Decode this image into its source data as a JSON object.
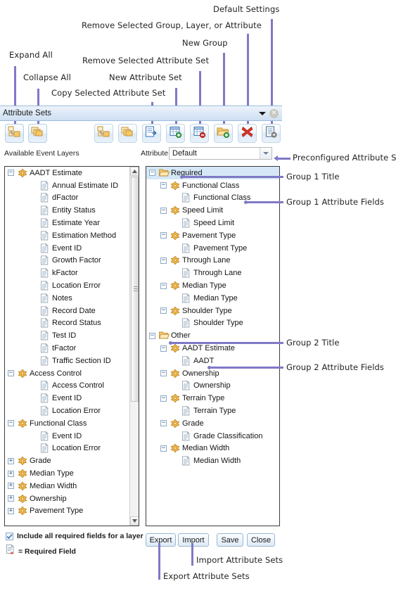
{
  "annotations": {
    "top": [
      {
        "text": "Default Settings"
      },
      {
        "text": "Remove Selected Group, Layer, or Attribute"
      },
      {
        "text": "New Group"
      },
      {
        "text": "Expand All"
      },
      {
        "text": "Remove Selected Attribute Set"
      },
      {
        "text": "Collapse All"
      },
      {
        "text": "New Attribute Set"
      },
      {
        "text": "Copy Selected Attribute Set"
      }
    ],
    "right": [
      {
        "text": "Preconfigured Attribute Set"
      },
      {
        "text": "Group 1 Title"
      },
      {
        "text": "Group 1 Attribute Fields"
      },
      {
        "text": "Group 2 Title"
      },
      {
        "text": "Group 2 Attribute Fields"
      }
    ],
    "bottom": [
      {
        "text": "Import Attribute Sets"
      },
      {
        "text": "Export Attribute Sets"
      }
    ]
  },
  "window": {
    "title": "Attribute Sets",
    "menu_icon": "chevron-down-icon",
    "close_icon": "close-icon"
  },
  "toolbar": {
    "buttons": [
      {
        "name": "expand-all",
        "icon": "expand-all-icon"
      },
      {
        "name": "collapse-all",
        "icon": "collapse-all-icon"
      },
      {
        "name": "expand-all-right",
        "icon": "expand-all-icon"
      },
      {
        "name": "collapse-all-right",
        "icon": "collapse-all-icon"
      },
      {
        "name": "copy-selected-attribute-set",
        "icon": "copy-attribute-set-icon"
      },
      {
        "name": "new-attribute-set",
        "icon": "new-attribute-set-icon"
      },
      {
        "name": "remove-selected-attribute-set",
        "icon": "remove-attribute-set-icon"
      },
      {
        "name": "new-group",
        "icon": "new-group-folder-icon"
      },
      {
        "name": "remove-selected-group-layer-attribute",
        "icon": "red-x-icon"
      },
      {
        "name": "default-settings",
        "icon": "default-settings-icon"
      }
    ]
  },
  "labels": {
    "available_event_layers": "Available Event Layers",
    "attribute_set": "Attribute Set:"
  },
  "attribute_set_combo": {
    "value": "Default",
    "options": [
      "Default"
    ]
  },
  "left_tree": {
    "nodes": [
      {
        "label": "AADT Estimate",
        "depth": 0,
        "icon": "layer-icon",
        "toggle": "minus"
      },
      {
        "label": "Annual Estimate ID",
        "depth": 2,
        "icon": "field-icon",
        "toggle": null
      },
      {
        "label": "dFactor",
        "depth": 2,
        "icon": "field-icon",
        "toggle": null
      },
      {
        "label": "Entity Status",
        "depth": 2,
        "icon": "field-icon",
        "toggle": null
      },
      {
        "label": "Estimate Year",
        "depth": 2,
        "icon": "field-icon",
        "toggle": null
      },
      {
        "label": "Estimation Method",
        "depth": 2,
        "icon": "field-icon",
        "toggle": null
      },
      {
        "label": "Event ID",
        "depth": 2,
        "icon": "field-icon",
        "toggle": null
      },
      {
        "label": "Growth Factor",
        "depth": 2,
        "icon": "field-icon",
        "toggle": null
      },
      {
        "label": "kFactor",
        "depth": 2,
        "icon": "field-icon",
        "toggle": null
      },
      {
        "label": "Location Error",
        "depth": 2,
        "icon": "field-icon",
        "toggle": null
      },
      {
        "label": "Notes",
        "depth": 2,
        "icon": "field-icon",
        "toggle": null
      },
      {
        "label": "Record Date",
        "depth": 2,
        "icon": "field-icon",
        "toggle": null
      },
      {
        "label": "Record Status",
        "depth": 2,
        "icon": "field-icon",
        "toggle": null
      },
      {
        "label": "Test ID",
        "depth": 2,
        "icon": "field-icon",
        "toggle": null
      },
      {
        "label": "tFactor",
        "depth": 2,
        "icon": "field-icon",
        "toggle": null
      },
      {
        "label": "Traffic Section ID",
        "depth": 2,
        "icon": "field-icon",
        "toggle": null
      },
      {
        "label": "Access Control",
        "depth": 0,
        "icon": "layer-icon",
        "toggle": "minus"
      },
      {
        "label": "Access Control",
        "depth": 2,
        "icon": "field-icon",
        "toggle": null
      },
      {
        "label": "Event ID",
        "depth": 2,
        "icon": "field-icon",
        "toggle": null
      },
      {
        "label": "Location Error",
        "depth": 2,
        "icon": "field-icon",
        "toggle": null
      },
      {
        "label": "Functional Class",
        "depth": 0,
        "icon": "layer-icon",
        "toggle": "minus"
      },
      {
        "label": "Event ID",
        "depth": 2,
        "icon": "field-icon",
        "toggle": null
      },
      {
        "label": "Location Error",
        "depth": 2,
        "icon": "field-icon",
        "toggle": null
      },
      {
        "label": "Grade",
        "depth": 0,
        "icon": "layer-icon",
        "toggle": "plus"
      },
      {
        "label": "Median Type",
        "depth": 0,
        "icon": "layer-icon",
        "toggle": "plus"
      },
      {
        "label": "Median Width",
        "depth": 0,
        "icon": "layer-icon",
        "toggle": "plus"
      },
      {
        "label": "Ownership",
        "depth": 0,
        "icon": "layer-icon",
        "toggle": "plus"
      },
      {
        "label": "Pavement Type",
        "depth": 0,
        "icon": "layer-icon",
        "toggle": "plus"
      }
    ]
  },
  "right_tree": {
    "nodes": [
      {
        "label": "Required",
        "depth": 0,
        "icon": "folder-icon",
        "toggle": "minus",
        "selected": true
      },
      {
        "label": "Functional Class",
        "depth": 1,
        "icon": "layer-icon",
        "toggle": "minus"
      },
      {
        "label": "Functional Class",
        "depth": 2,
        "icon": "field-icon",
        "toggle": null
      },
      {
        "label": "Speed Limit",
        "depth": 1,
        "icon": "layer-icon",
        "toggle": "minus"
      },
      {
        "label": "Speed Limit",
        "depth": 2,
        "icon": "field-icon",
        "toggle": null
      },
      {
        "label": "Pavement Type",
        "depth": 1,
        "icon": "layer-icon",
        "toggle": "minus"
      },
      {
        "label": "Pavement Type",
        "depth": 2,
        "icon": "field-icon",
        "toggle": null
      },
      {
        "label": "Through Lane",
        "depth": 1,
        "icon": "layer-icon",
        "toggle": "minus"
      },
      {
        "label": "Through Lane",
        "depth": 2,
        "icon": "field-icon",
        "toggle": null
      },
      {
        "label": "Median Type",
        "depth": 1,
        "icon": "layer-icon",
        "toggle": "minus"
      },
      {
        "label": "Median Type",
        "depth": 2,
        "icon": "field-icon",
        "toggle": null
      },
      {
        "label": "Shoulder Type",
        "depth": 1,
        "icon": "layer-icon",
        "toggle": "minus"
      },
      {
        "label": "Shoulder Type",
        "depth": 2,
        "icon": "field-icon",
        "toggle": null
      },
      {
        "label": "Other",
        "depth": 0,
        "icon": "folder-icon",
        "toggle": "minus"
      },
      {
        "label": "AADT Estimate",
        "depth": 1,
        "icon": "layer-icon",
        "toggle": "minus"
      },
      {
        "label": "AADT",
        "depth": 2,
        "icon": "field-icon",
        "toggle": null
      },
      {
        "label": "Ownership",
        "depth": 1,
        "icon": "layer-icon",
        "toggle": "minus"
      },
      {
        "label": "Ownership",
        "depth": 2,
        "icon": "field-icon",
        "toggle": null
      },
      {
        "label": "Terrain Type",
        "depth": 1,
        "icon": "layer-icon",
        "toggle": "minus"
      },
      {
        "label": "Terrain Type",
        "depth": 2,
        "icon": "field-icon",
        "toggle": null
      },
      {
        "label": "Grade",
        "depth": 1,
        "icon": "layer-icon",
        "toggle": "minus"
      },
      {
        "label": "Grade Classification",
        "depth": 2,
        "icon": "field-icon",
        "toggle": null
      },
      {
        "label": "Median Width",
        "depth": 1,
        "icon": "layer-icon",
        "toggle": "minus"
      },
      {
        "label": "Median Width",
        "depth": 2,
        "icon": "field-icon",
        "toggle": null
      }
    ]
  },
  "footer": {
    "include_required_checkbox": {
      "label": "Include all required fields for a layer",
      "checked": true
    },
    "required_field_legend": "= Required Field",
    "buttons": [
      {
        "label": "Export",
        "name": "export-button"
      },
      {
        "label": "Import",
        "name": "import-button"
      },
      {
        "label": "Save",
        "name": "save-button"
      },
      {
        "label": "Close",
        "name": "close-button"
      }
    ]
  },
  "colors": {
    "annotation": "#8079c7",
    "titlebar": "#cfe0f3",
    "selection": "#d6e8f7",
    "layer_icon": "#e8a33d",
    "folder_icon": "#f0b03c",
    "red_x": "#d83a2e"
  }
}
